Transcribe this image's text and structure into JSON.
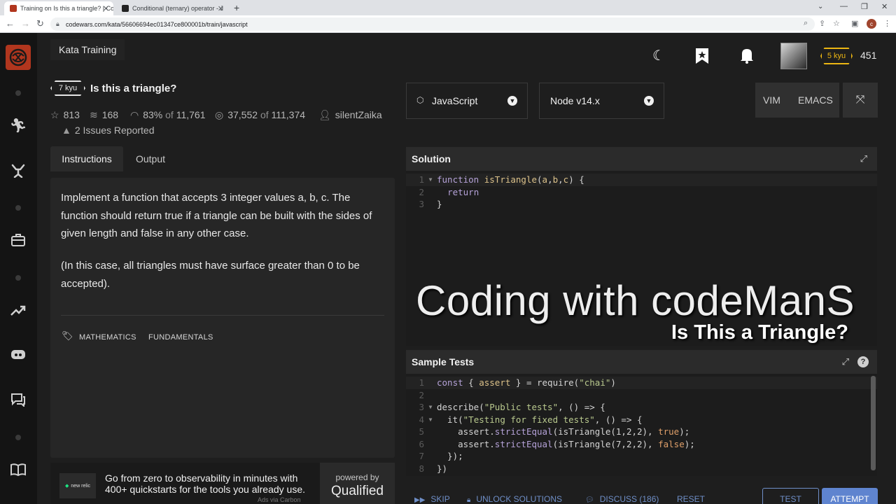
{
  "browser": {
    "tabs": [
      {
        "label": "Training on Is this a triangle? | Co",
        "active": true
      },
      {
        "label": "Conditional (ternary) operator - J",
        "active": false
      }
    ],
    "new_tab": "+",
    "url": "codewars.com/kata/56606694ec01347ce800001b/train/javascript",
    "profile_initial": "c"
  },
  "header": {
    "title": "Kata Training",
    "rank": "5 kyu",
    "honor": "451"
  },
  "kata": {
    "rank": "7 kyu",
    "title": "Is this a triangle?",
    "stats": {
      "stars": "813",
      "collections": "168",
      "satisfaction_pct": "83%",
      "of_label": "of",
      "satisfaction_votes": "11,761",
      "completed": "37,552",
      "attempts": "111,374",
      "author": "silentZaika"
    },
    "issues": "2 Issues Reported"
  },
  "instruction_tabs": {
    "instructions": "Instructions",
    "output": "Output"
  },
  "description": {
    "paragraph1": "Implement a function that accepts 3 integer values a, b, c. The function should return true if a triangle can be built with the sides of given length and false in any other case.",
    "paragraph2": "(In this case, all triangles must have surface greater than 0 to be accepted).",
    "tags": [
      "MATHEMATICS",
      "FUNDAMENTALS"
    ]
  },
  "ad": {
    "logo": "new relic",
    "text": "Go from zero to observability in minutes with 400+ quickstarts for the tools you already use.",
    "via": "Ads via Carbon",
    "powered_by": "powered by",
    "brand": "Qualified"
  },
  "editor_options": {
    "language": "JavaScript",
    "runtime": "Node v14.x",
    "vim": "VIM",
    "emacs": "EMACS"
  },
  "solution": {
    "title": "Solution",
    "line_numbers": [
      "1",
      "2",
      "3"
    ]
  },
  "sample_tests": {
    "title": "Sample Tests",
    "line_numbers": [
      "1",
      "2",
      "3",
      "4",
      "5",
      "6",
      "7",
      "8"
    ]
  },
  "watermark": {
    "line1": "Coding with codeManS",
    "line2": "Is This a Triangle?"
  },
  "footer": {
    "skip": "SKIP",
    "unlock": "UNLOCK SOLUTIONS",
    "discuss": "DISCUSS (186)",
    "reset": "RESET",
    "test": "TEST",
    "attempt": "ATTEMPT"
  },
  "colors": {
    "accent": "#5f84cf",
    "rank_yellow": "#ecb613",
    "brand_red": "#b1361e"
  }
}
